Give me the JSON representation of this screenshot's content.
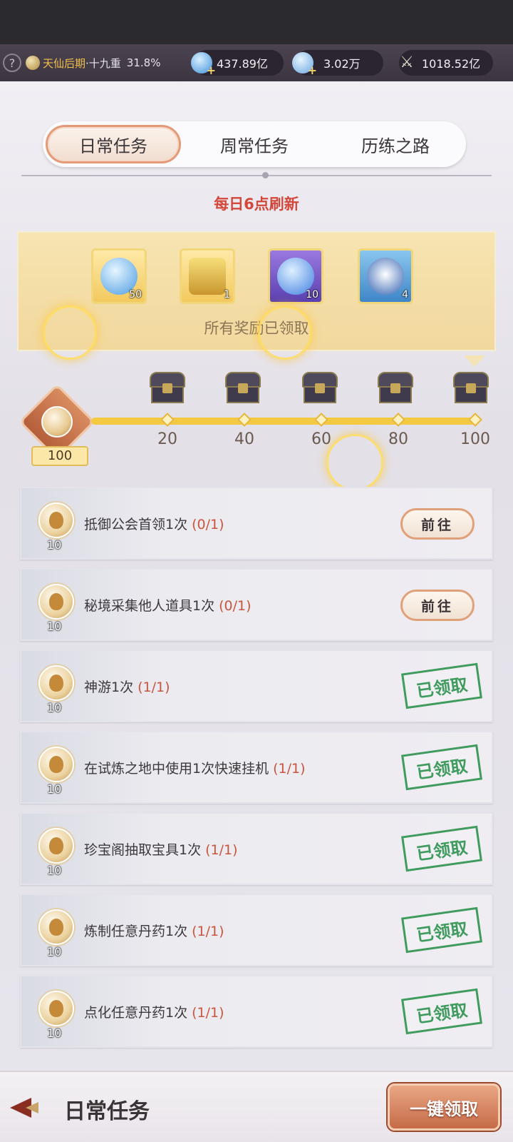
{
  "topbar": {
    "help_icon": "?",
    "realm_name": "天仙后期",
    "realm_sep": "·十九重",
    "realm_pct": "31.8%",
    "currency1": "437.89亿",
    "currency2": "3.02万",
    "power": "1018.52亿",
    "plus": "+"
  },
  "tabs": [
    "日常任务",
    "周常任务",
    "历练之路"
  ],
  "active_tab": 0,
  "refresh_text": "每日6点刷新",
  "rewards": {
    "items": [
      {
        "icon": "blue-cloud-icon",
        "count": "50"
      },
      {
        "icon": "golden-lantern-icon",
        "count": "1"
      },
      {
        "icon": "purple-orb-icon",
        "count": "10"
      },
      {
        "icon": "blue-flame-icon",
        "count": "4"
      }
    ],
    "status": "所有奖励已领取"
  },
  "progress": {
    "current_points": "100",
    "fill_fraction": 1.0,
    "ticks": [
      "20",
      "40",
      "60",
      "80",
      "100"
    ]
  },
  "tasks": [
    {
      "points": "10",
      "name": "抵御公会首领1次",
      "progress": "(0/1)",
      "state": "go"
    },
    {
      "points": "10",
      "name": "秘境采集他人道具1次",
      "progress": "(0/1)",
      "state": "go"
    },
    {
      "points": "10",
      "name": "神游1次",
      "progress": "(1/1)",
      "state": "claimed"
    },
    {
      "points": "10",
      "name": "在试炼之地中使用1次快速挂机",
      "progress": "(1/1)",
      "state": "claimed"
    },
    {
      "points": "10",
      "name": "珍宝阁抽取宝具1次",
      "progress": "(1/1)",
      "state": "claimed"
    },
    {
      "points": "10",
      "name": "炼制任意丹药1次",
      "progress": "(1/1)",
      "state": "claimed"
    },
    {
      "points": "10",
      "name": "点化任意丹药1次",
      "progress": "(1/1)",
      "state": "claimed"
    }
  ],
  "labels": {
    "go": "前往",
    "claimed": "已领取"
  },
  "bottom": {
    "title": "日常任务",
    "claim_all": "一键领取"
  },
  "colors": {
    "accent": "#e29a78",
    "refresh_red": "#d2483a",
    "stamp_green": "#3f9b5e",
    "progress_yellow": "#f2c941"
  }
}
